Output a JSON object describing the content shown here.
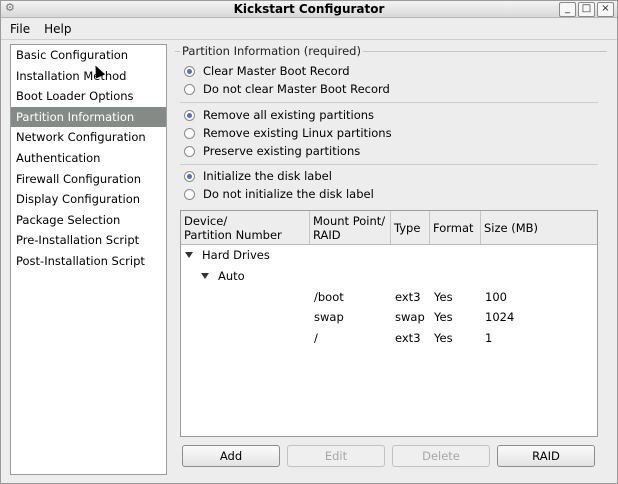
{
  "window": {
    "title": "Kickstart Configurator",
    "controls": [
      "_",
      "□",
      "×"
    ]
  },
  "menu": {
    "file": "File",
    "help": "Help"
  },
  "sidebar": {
    "items": [
      "Basic Configuration",
      "Installation Method",
      "Boot Loader Options",
      "Partition Information",
      "Network Configuration",
      "Authentication",
      "Firewall Configuration",
      "Display Configuration",
      "Package Selection",
      "Pre-Installation Script",
      "Post-Installation Script"
    ],
    "selected_index": 3
  },
  "panel": {
    "group_title": "Partition Information (required)",
    "mbr": {
      "opt1": "Clear Master Boot Record",
      "opt2": "Do not clear Master Boot Record",
      "selected": 1
    },
    "partitions": {
      "opt1": "Remove all existing partitions",
      "opt2": "Remove existing Linux partitions",
      "opt3": "Preserve existing partitions",
      "selected": 1
    },
    "disklabel": {
      "opt1": "Initialize the disk label",
      "opt2": "Do not initialize the disk label",
      "selected": 1
    }
  },
  "table": {
    "headers": {
      "device": "Device/\nPartition Number",
      "mount": "Mount Point/\nRAID",
      "type": "Type",
      "format": "Format",
      "size": "Size (MB)"
    },
    "tree": {
      "root": "Hard Drives",
      "child": "Auto"
    },
    "rows": [
      {
        "mount": "/boot",
        "type": "ext3",
        "format": "Yes",
        "size": "100"
      },
      {
        "mount": "swap",
        "type": "swap",
        "format": "Yes",
        "size": "1024"
      },
      {
        "mount": "/",
        "type": "ext3",
        "format": "Yes",
        "size": "1"
      }
    ]
  },
  "buttons": {
    "add": "Add",
    "edit": "Edit",
    "delete": "Delete",
    "raid": "RAID"
  },
  "colors": {
    "selection": "#868a86",
    "radio_dot": "#4a74c9"
  }
}
